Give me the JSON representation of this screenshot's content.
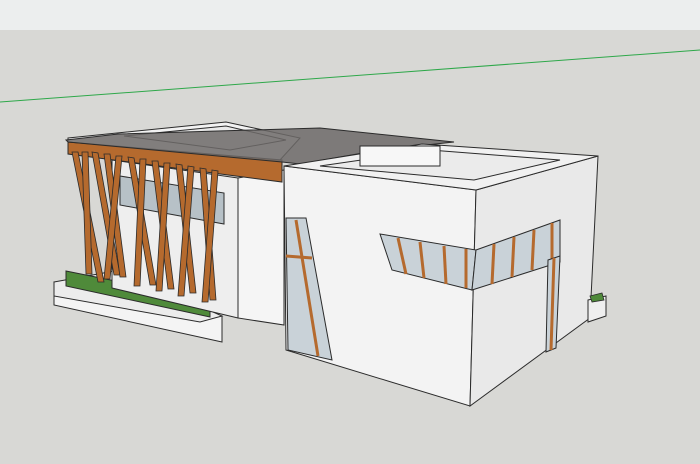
{
  "window": {
    "title": ""
  },
  "viewport": {
    "mode": "3D model view",
    "colors": {
      "sky": "#eceeee",
      "ground": "#d8d8d5",
      "wall": "#f3f3f3",
      "wall_shadow": "#e6e6e6",
      "outline": "#2b2b2b",
      "wood": "#b56a2e",
      "wood_dark": "#8a4f21",
      "glass": "#c9d2d8",
      "hedge": "#4f8a3a",
      "roof_glass": "#6d6a68",
      "horizon": "#2ea84a"
    },
    "icons": [
      "house-model-icon"
    ]
  }
}
